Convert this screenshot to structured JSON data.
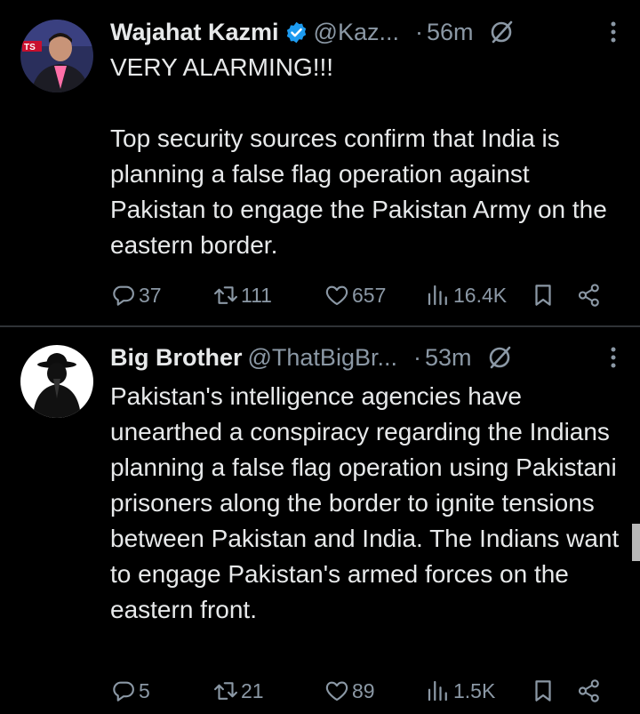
{
  "tweets": [
    {
      "name": "Wajahat Kazmi",
      "verified": true,
      "handle": "@Kaz...",
      "dot": "·",
      "time": "56m",
      "text": "VERY ALARMING!!!\n\nTop security sources confirm that India is planning a false flag operation against Pakistan to engage the Pakistan Army on the eastern border.",
      "replies": "37",
      "retweets": "111",
      "likes": "657",
      "views": "16.4K"
    },
    {
      "name": "Big Brother",
      "verified": false,
      "handle": "@ThatBigBr...",
      "dot": "·",
      "time": "53m",
      "text": "Pakistan's intelligence agencies have unearthed a conspiracy regarding the Indians planning a false flag operation using Pakistani prisoners along the border to ignite tensions between Pakistan and India. The Indians want to engage Pakistan's armed forces on the eastern front.",
      "replies": "5",
      "retweets": "21",
      "likes": "89",
      "views": "1.5K"
    }
  ],
  "avatar_1_badge": "TS",
  "colors": {
    "background": "#000000",
    "text": "#e7e9ea",
    "muted": "#8b98a5",
    "verified": "#1d9bf0",
    "divider": "#2f3336"
  }
}
